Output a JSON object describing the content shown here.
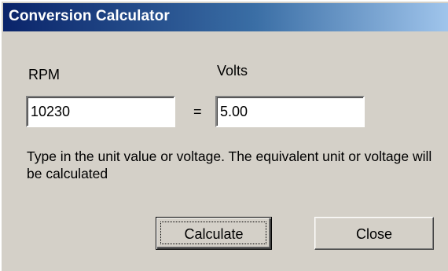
{
  "window": {
    "title": "Conversion Calculator"
  },
  "fields": {
    "rpm_label": "RPM",
    "rpm_value": "10230",
    "equals_sign": "=",
    "volts_label": "Volts",
    "volts_value": "5.00"
  },
  "help_text": "Type in the unit value or voltage. The equivalent unit or voltage will be calculated",
  "buttons": {
    "calculate_label": "Calculate",
    "close_label": "Close"
  },
  "colors": {
    "titlebar_start": "#0a246a",
    "titlebar_end": "#a6caf0",
    "dialog_face": "#d4d0c8"
  }
}
